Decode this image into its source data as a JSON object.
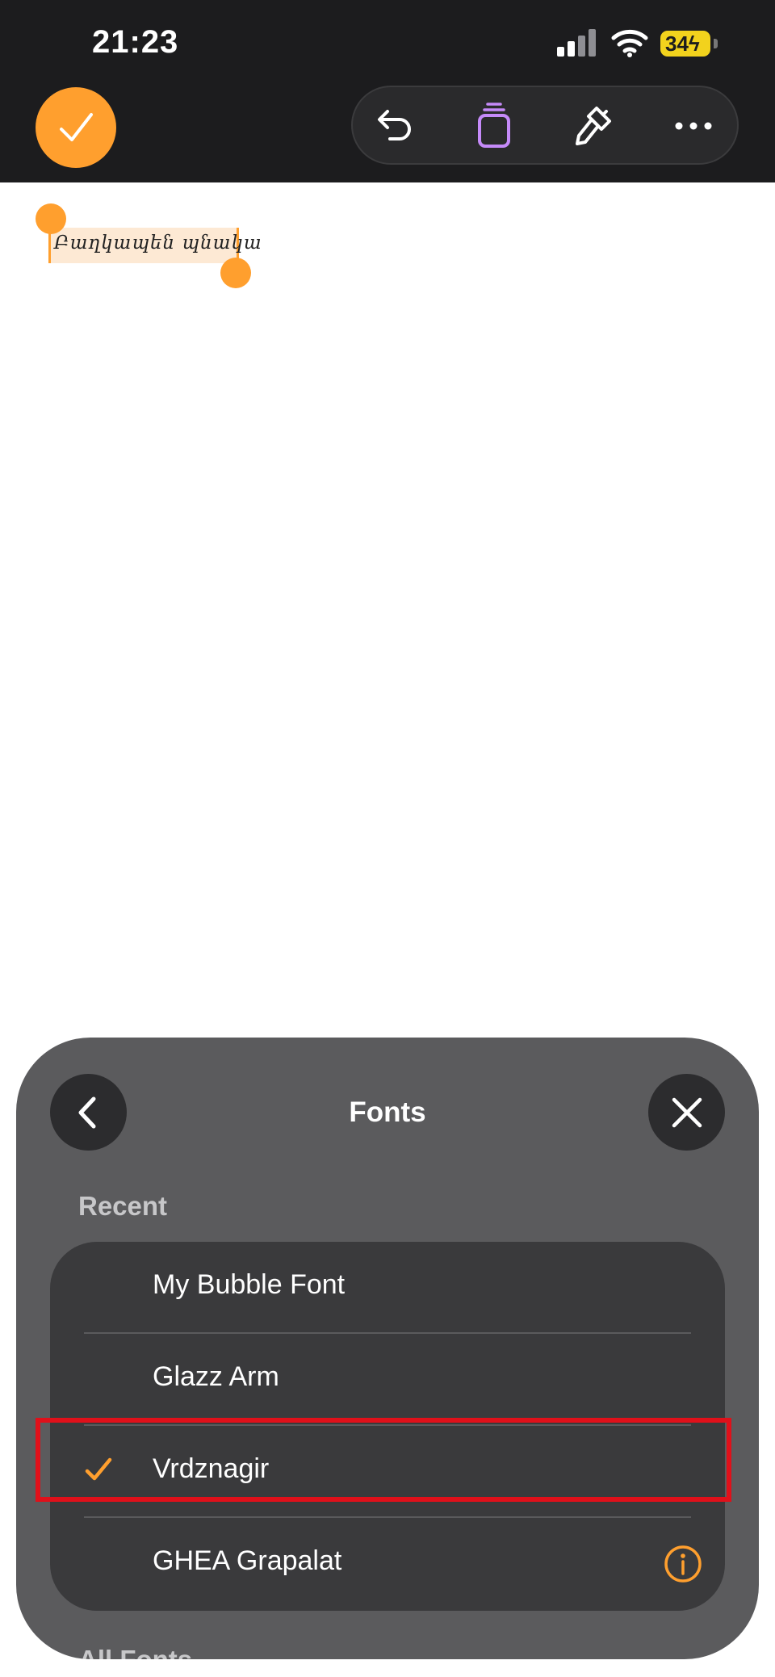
{
  "status_bar": {
    "time": "21:23",
    "battery": "34"
  },
  "toolbar": {
    "done_icon": "checkmark-icon",
    "undo_icon": "undo-icon",
    "layers_icon": "layers-icon",
    "brush_icon": "brush-icon",
    "more_icon": "ellipsis-icon",
    "accent_color": "#ff9f2e",
    "layers_color": "#c58af9"
  },
  "canvas": {
    "selected_text": "Բաղկապեն պնակա"
  },
  "fonts_sheet": {
    "title": "Fonts",
    "back_icon": "chevron-left-icon",
    "close_icon": "close-icon",
    "section_recent": "Recent",
    "recent_fonts": [
      {
        "label": "My Bubble Font",
        "selected": false
      },
      {
        "label": "Glazz Arm",
        "selected": false
      },
      {
        "label": "Vrdznagir",
        "selected": true
      },
      {
        "label": "GHEA Grapalat",
        "selected": false,
        "has_info": true
      }
    ],
    "section_all": "All Fonts"
  }
}
